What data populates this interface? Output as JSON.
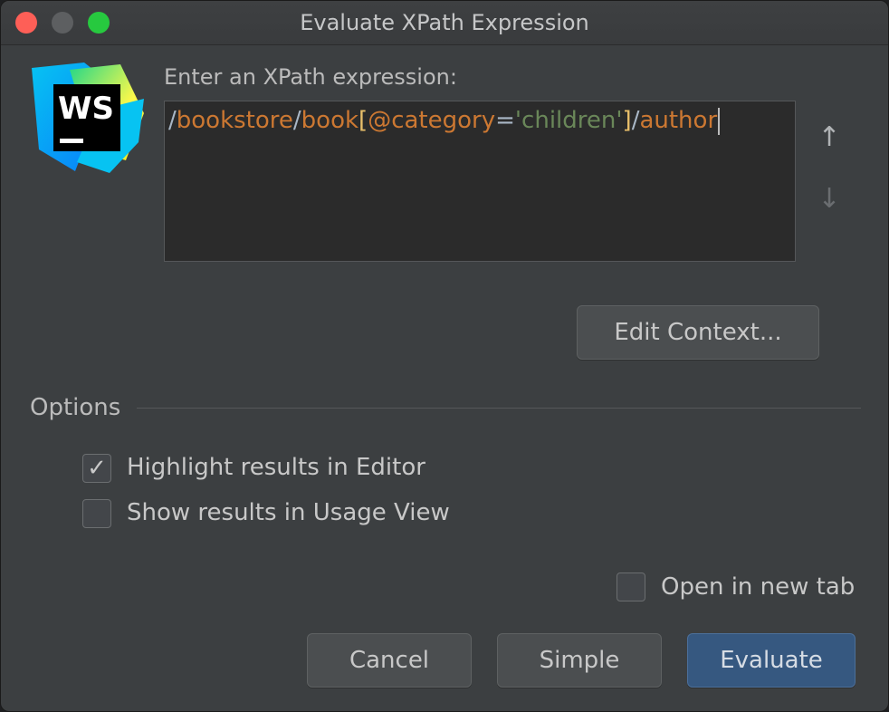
{
  "window": {
    "title": "Evaluate XPath Expression"
  },
  "logo": {
    "text": "WS"
  },
  "prompt_label": "Enter an XPath expression:",
  "expression": {
    "tokens": [
      {
        "text": "/",
        "kind": "slash"
      },
      {
        "text": "bookstore",
        "kind": "name"
      },
      {
        "text": "/",
        "kind": "slash"
      },
      {
        "text": "book",
        "kind": "name"
      },
      {
        "text": "[",
        "kind": "bracket"
      },
      {
        "text": "@category",
        "kind": "name"
      },
      {
        "text": "=",
        "kind": "eq"
      },
      {
        "text": "'children'",
        "kind": "str"
      },
      {
        "text": "]",
        "kind": "bracket"
      },
      {
        "text": "/",
        "kind": "slash"
      },
      {
        "text": "author",
        "kind": "name"
      }
    ]
  },
  "history": {
    "up_icon": "arrow-up-icon",
    "down_icon": "arrow-down-icon"
  },
  "edit_context_label": "Edit Context...",
  "options": {
    "title": "Options",
    "highlight": {
      "label": "Highlight results in Editor",
      "checked": true
    },
    "usage_view": {
      "label": "Show results in Usage View",
      "checked": false
    },
    "new_tab": {
      "label": "Open in new tab",
      "checked": false
    }
  },
  "buttons": {
    "cancel": "Cancel",
    "simple": "Simple",
    "evaluate": "Evaluate"
  },
  "colors": {
    "background": "#3c3f41",
    "editor_bg": "#2b2b2b",
    "keyword_orange": "#cc7832",
    "string_green": "#6a8759",
    "bracket_yellow": "#e8bf6a",
    "default_button": "#365880"
  }
}
